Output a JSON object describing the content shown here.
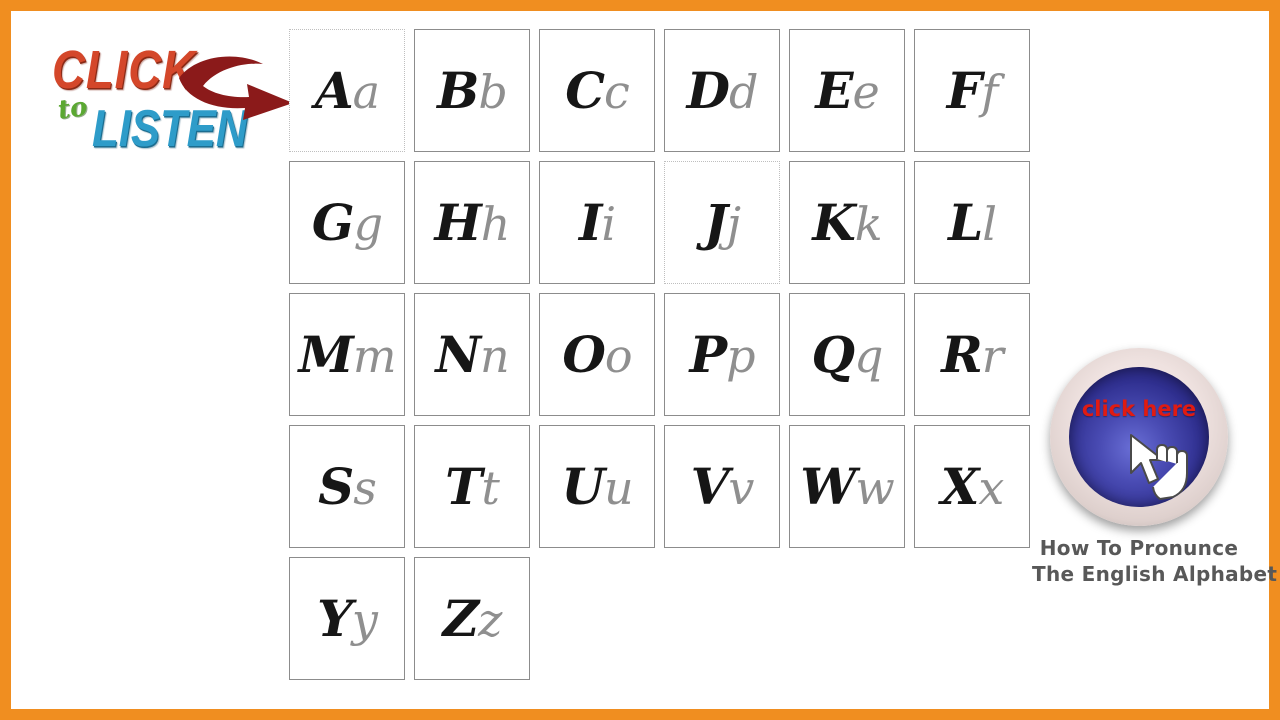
{
  "page": {
    "background_color": "#ffffff",
    "frame_color": "#F08E20"
  },
  "logo": {
    "line1": "CLICK",
    "line2_small": "to",
    "line3": "LISTEN",
    "click_color": "#D4472A",
    "to_color": "#5BA832",
    "listen_color": "#2E9CC9",
    "arrow_color": "#8B1A1A",
    "arrow_name": "curved-arrow-icon"
  },
  "alphabet": {
    "columns": 6,
    "rows": 5,
    "upper_color": "#161616",
    "lower_color": "#8f8f8f",
    "cell_border_color": "#8c8c8c",
    "selected_border_color": "#bfbfbf",
    "cells": [
      {
        "upper": "A",
        "lower": "a",
        "selected": true
      },
      {
        "upper": "B",
        "lower": "b",
        "selected": false
      },
      {
        "upper": "C",
        "lower": "c",
        "selected": false
      },
      {
        "upper": "D",
        "lower": "d",
        "selected": false
      },
      {
        "upper": "E",
        "lower": "e",
        "selected": false
      },
      {
        "upper": "F",
        "lower": "f",
        "selected": false
      },
      {
        "upper": "G",
        "lower": "g",
        "selected": false
      },
      {
        "upper": "H",
        "lower": "h",
        "selected": false
      },
      {
        "upper": "I",
        "lower": "i",
        "selected": false
      },
      {
        "upper": "J",
        "lower": "j",
        "selected": true
      },
      {
        "upper": "K",
        "lower": "k",
        "selected": false
      },
      {
        "upper": "L",
        "lower": "l",
        "selected": false
      },
      {
        "upper": "M",
        "lower": "m",
        "selected": false
      },
      {
        "upper": "N",
        "lower": "n",
        "selected": false
      },
      {
        "upper": "O",
        "lower": "o",
        "selected": false
      },
      {
        "upper": "P",
        "lower": "p",
        "selected": false
      },
      {
        "upper": "Q",
        "lower": "q",
        "selected": false
      },
      {
        "upper": "R",
        "lower": "r",
        "selected": false
      },
      {
        "upper": "S",
        "lower": "s",
        "selected": false
      },
      {
        "upper": "T",
        "lower": "t",
        "selected": false
      },
      {
        "upper": "U",
        "lower": "u",
        "selected": false
      },
      {
        "upper": "V",
        "lower": "v",
        "selected": false
      },
      {
        "upper": "W",
        "lower": "w",
        "selected": false
      },
      {
        "upper": "X",
        "lower": "x",
        "selected": false
      },
      {
        "upper": "Y",
        "lower": "y",
        "selected": false
      },
      {
        "upper": "Z",
        "lower": "z",
        "selected": false
      }
    ]
  },
  "pronounce_panel": {
    "button_label": "click here",
    "button_label_color": "#E01B12",
    "button_face_color": "#2f2f8f",
    "button_ring_color": "#efe2e0",
    "cursor_name": "hand-pointer-cursor",
    "caption_line1": "How To Pronunce",
    "caption_line2": "The English Alphabet",
    "caption_color": "#585858"
  }
}
